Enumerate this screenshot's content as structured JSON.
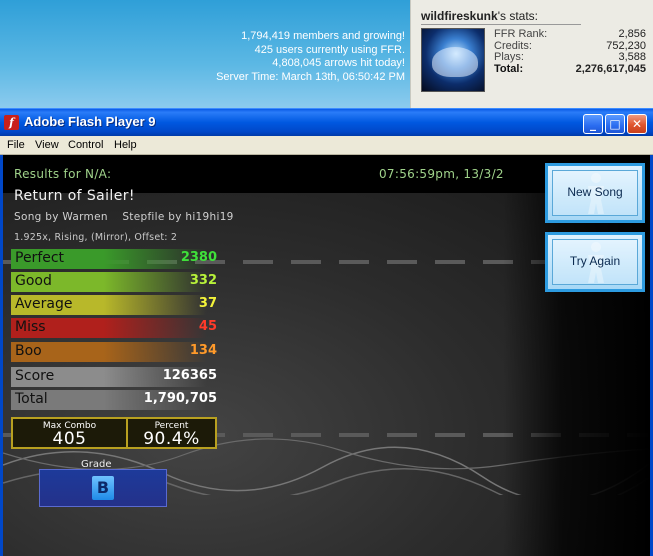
{
  "site": {
    "members_line": "1,794,419 members and growing!",
    "users_line": "425 users currently using FFR.",
    "arrows_line": "4,808,045 arrows hit today!",
    "server_time_line": "Server Time: March 13th, 06:50:42 PM"
  },
  "user_stats": {
    "username": "wildfireskunk",
    "title_suffix": "'s stats:",
    "rows": [
      {
        "label": "FFR Rank:",
        "value": "2,856"
      },
      {
        "label": "Credits:",
        "value": "752,230"
      },
      {
        "label": "Plays:",
        "value": "3,588"
      },
      {
        "label": "Total:",
        "value": "2,276,617,045"
      }
    ]
  },
  "window": {
    "title": "Adobe Flash Player 9",
    "icon_letter": "f",
    "buttons": {
      "minimize": "_",
      "maximize": "□",
      "close": "✕"
    },
    "menu": [
      "File",
      "View",
      "Control",
      "Help"
    ]
  },
  "results": {
    "header": "Results for N/A:",
    "timestamp": "07:56:59pm, 13/3/2",
    "song_title": "Return of Sailer!",
    "song_by": "Song by Warmen    Stepfile by hi19hi19",
    "details": "1.925x, Rising, (Mirror), Offset: 2",
    "judgements": [
      {
        "label": "Perfect",
        "value": "2380",
        "bar": "#3a9a2a",
        "text": "#3fe03a"
      },
      {
        "label": "Good",
        "value": "332",
        "bar": "#7cb82a",
        "text": "#b8f23a"
      },
      {
        "label": "Average",
        "value": "37",
        "bar": "#b8b82a",
        "text": "#f2f23a"
      },
      {
        "label": "Miss",
        "value": "45",
        "bar": "#b0201c",
        "text": "#ff3a2a"
      },
      {
        "label": "Boo",
        "value": "134",
        "bar": "#a8641a",
        "text": "#ff9a2a"
      },
      {
        "label": "Score",
        "value": "126365",
        "bar": "#8c8c8c",
        "text": "#ffffff"
      },
      {
        "label": "Total",
        "value": "1,790,705",
        "bar": "#7a7a7a",
        "text": "#ffffff"
      }
    ],
    "max_combo_label": "Max Combo",
    "max_combo": "405",
    "percent_label": "Percent",
    "percent": "90.4%",
    "grade_label": "Grade",
    "grade": "B"
  },
  "actions": {
    "new_song": "New Song",
    "try_again": "Try Again"
  },
  "colors": {
    "titlebar_blue": "#0058e0",
    "accent_green": "#9fd28a",
    "button_border": "#2d9be0"
  }
}
